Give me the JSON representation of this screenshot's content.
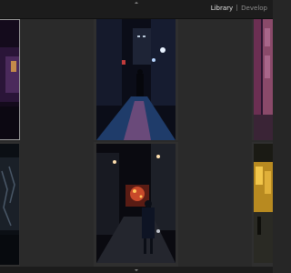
{
  "header": {
    "modules": [
      {
        "label": "Library",
        "active": true
      },
      {
        "label": "Develop",
        "active": false
      }
    ]
  },
  "grid": {
    "thumbnails": [
      {
        "name": "thumb-purple-alley",
        "selected": true
      },
      {
        "name": "thumb-blue-street-walker",
        "selected": false
      },
      {
        "name": "thumb-pink-wall-edge",
        "selected": false
      },
      {
        "name": "thumb-graffiti-tunnel",
        "selected": false
      },
      {
        "name": "thumb-red-light-walker",
        "selected": false
      },
      {
        "name": "thumb-yellow-storefront",
        "selected": false
      }
    ]
  },
  "colors": {
    "background": "#262626",
    "panel": "#1c1c1c",
    "active_text": "#e6e6e6",
    "inactive_text": "#8c8c8c"
  }
}
